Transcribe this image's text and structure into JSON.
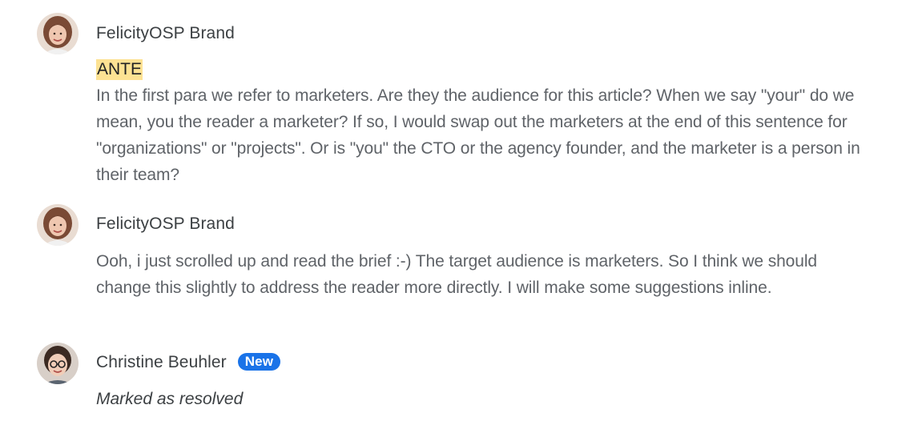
{
  "comments": [
    {
      "author": "FelicityOSP Brand",
      "quoted_text": "ANTE",
      "text": "In the first para we refer to marketers. Are they the audience for this article? When we say \"your\" do we mean, you the reader a marketer? If so, I would swap out the marketers at the end of this sentence for \"organizations\" or \"projects\". Or is \"you\" the CTO or the agency founder, and the marketer is a person in their team?"
    },
    {
      "author": "FelicityOSP Brand",
      "text": "Ooh, i just scrolled up and read the brief :-) The target audience is marketers. So I think we should change this slightly to address the reader more directly. I will make some suggestions inline."
    },
    {
      "author": "Christine Beuhler",
      "badge": "New",
      "status": "Marked as resolved"
    }
  ],
  "colors": {
    "highlight": "#fde293",
    "badge": "#1a73e8",
    "body_text": "#5f6368",
    "author_text": "#3c4043"
  }
}
